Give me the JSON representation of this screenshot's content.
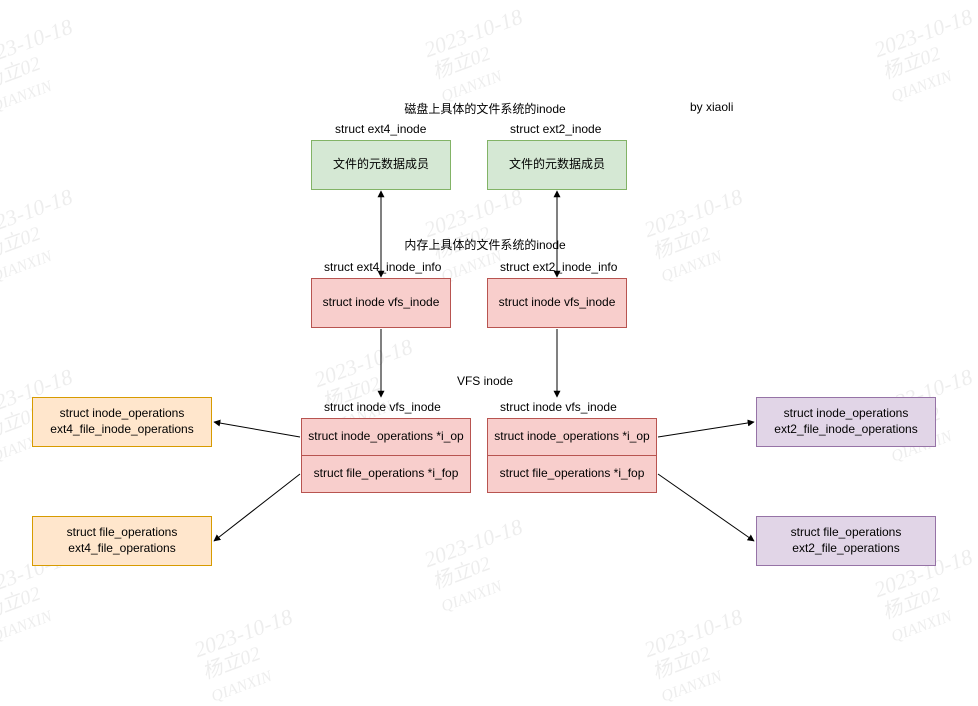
{
  "watermark": {
    "line1": "2023-10-18",
    "line2": "杨立02",
    "line3": "QIANXIN"
  },
  "byline": "by xiaoli",
  "title_disk": "磁盘上具体的文件系统的inode",
  "ext4": {
    "struct_label": "struct ext4_inode",
    "meta_box": "文件的元数据成员",
    "info_label": "struct ext4_inode_info",
    "vfs_box": "struct inode vfs_inode",
    "bottom_label": "struct inode vfs_inode",
    "iop_box": "struct inode_operations *i_op",
    "fop_box": "struct file_operations *i_fop",
    "inode_ops_box": "struct inode_operations\next4_file_inode_operations",
    "file_ops_box": "struct file_operations\next4_file_operations"
  },
  "ext2": {
    "struct_label": "struct ext2_inode",
    "meta_box": "文件的元数据成员",
    "info_label": "struct ext2_inode_info",
    "vfs_box": "struct inode vfs_inode",
    "bottom_label": "struct inode vfs_inode",
    "iop_box": "struct inode_operations *i_op",
    "fop_box": "struct file_operations *i_fop",
    "inode_ops_box": "struct inode_operations\next2_file_inode_operations",
    "file_ops_box": "struct file_operations\next2_file_operations"
  },
  "title_mem": "内存上具体的文件系统的inode",
  "title_vfs": "VFS inode"
}
